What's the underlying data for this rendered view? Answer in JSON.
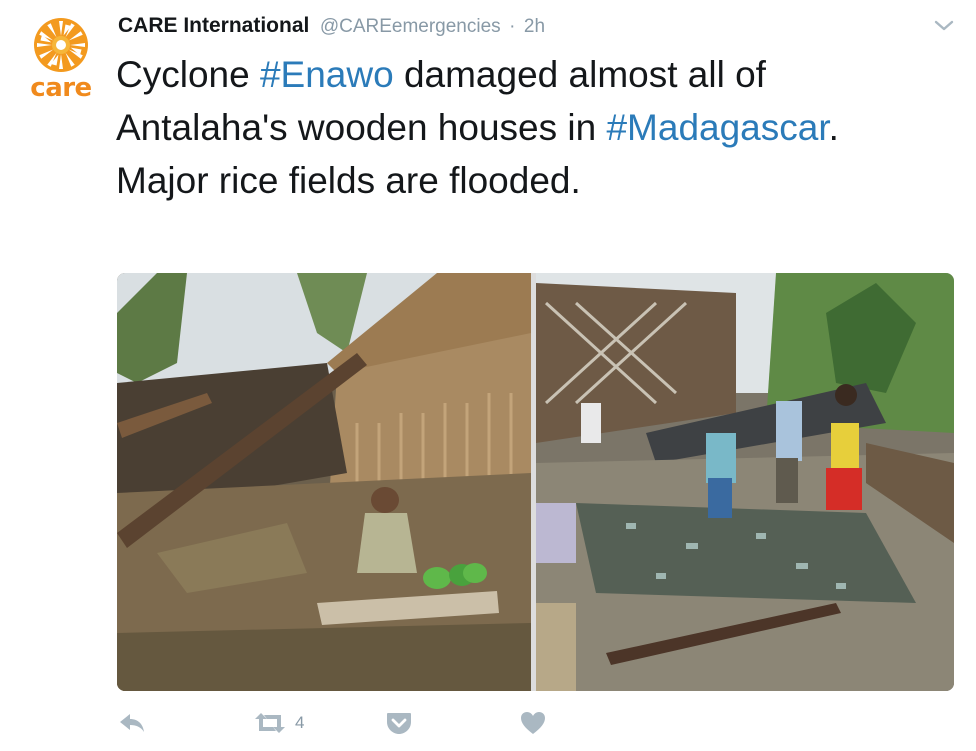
{
  "tweet": {
    "author_name": "CARE International",
    "author_handle": "@CAREemergencies",
    "separator": "·",
    "time": "2h",
    "avatar_logo_text": "care",
    "text_parts": {
      "p1": "Cyclone ",
      "hashtag1": "#Enawo",
      "p2": " damaged almost all of Antalaha's wooden houses in ",
      "hashtag2": "#Madagascar",
      "p3": ". Major rice fields are flooded."
    },
    "retweet_count": "4"
  },
  "colors": {
    "brand_orange": "#f08a1d",
    "hashtag_blue": "#2b7bb9",
    "muted_gray": "#8899a6",
    "action_icon": "#aab8c2"
  },
  "icons": {
    "reply": "reply-icon",
    "retweet": "retweet-icon",
    "save": "pocket-icon",
    "like": "heart-icon",
    "menu": "chevron-down-icon"
  }
}
